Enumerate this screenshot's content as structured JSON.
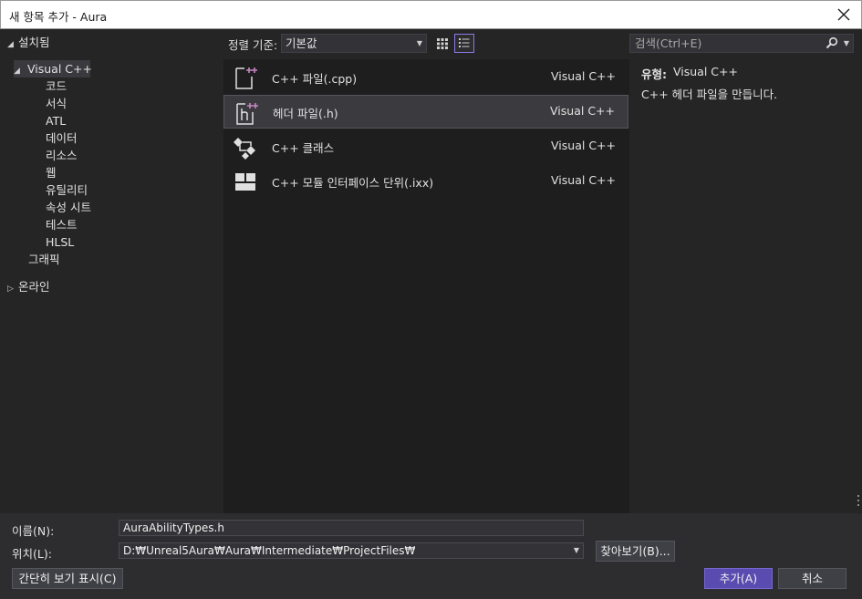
{
  "window": {
    "title": "새 항목 추가 - Aura"
  },
  "left_tree": {
    "installed": "설치됨",
    "visual_cpp": "Visual C++",
    "children": [
      "코드",
      "서식",
      "ATL",
      "데이터",
      "리소스",
      "웹",
      "유틸리티",
      "속성 시트",
      "테스트",
      "HLSL"
    ],
    "graphics": "그래픽",
    "online": "온라인"
  },
  "toolbar": {
    "sort_label": "정렬 기준:",
    "sort_value": "기본값"
  },
  "search": {
    "placeholder": "검색(Ctrl+E)"
  },
  "items": [
    {
      "name": "C++ 파일(.cpp)",
      "lang": "Visual C++",
      "icon": "cpp-file-icon"
    },
    {
      "name": "헤더 파일(.h)",
      "lang": "Visual C++",
      "icon": "header-file-icon",
      "selected": true
    },
    {
      "name": "C++ 클래스",
      "lang": "Visual C++",
      "icon": "class-icon"
    },
    {
      "name": "C++ 모듈 인터페이스 단위(.ixx)",
      "lang": "Visual C++",
      "icon": "module-icon"
    }
  ],
  "details": {
    "type_label": "유형:",
    "type_value": "Visual C++",
    "description": "C++ 헤더 파일을 만듭니다."
  },
  "bottom": {
    "name_label": "이름(N):",
    "name_value": "AuraAbilityTypes.h",
    "location_label": "위치(L):",
    "location_value": "D:₩Unreal5Aura₩Aura₩Intermediate₩ProjectFiles₩",
    "browse_label": "찾아보기(B)...",
    "compact_label": "간단히 보기 표시(C)",
    "add_label": "추가(A)",
    "cancel_label": "취소"
  },
  "colors": {
    "accent": "#5a4bb0",
    "icon_accent": "#c586c0"
  }
}
